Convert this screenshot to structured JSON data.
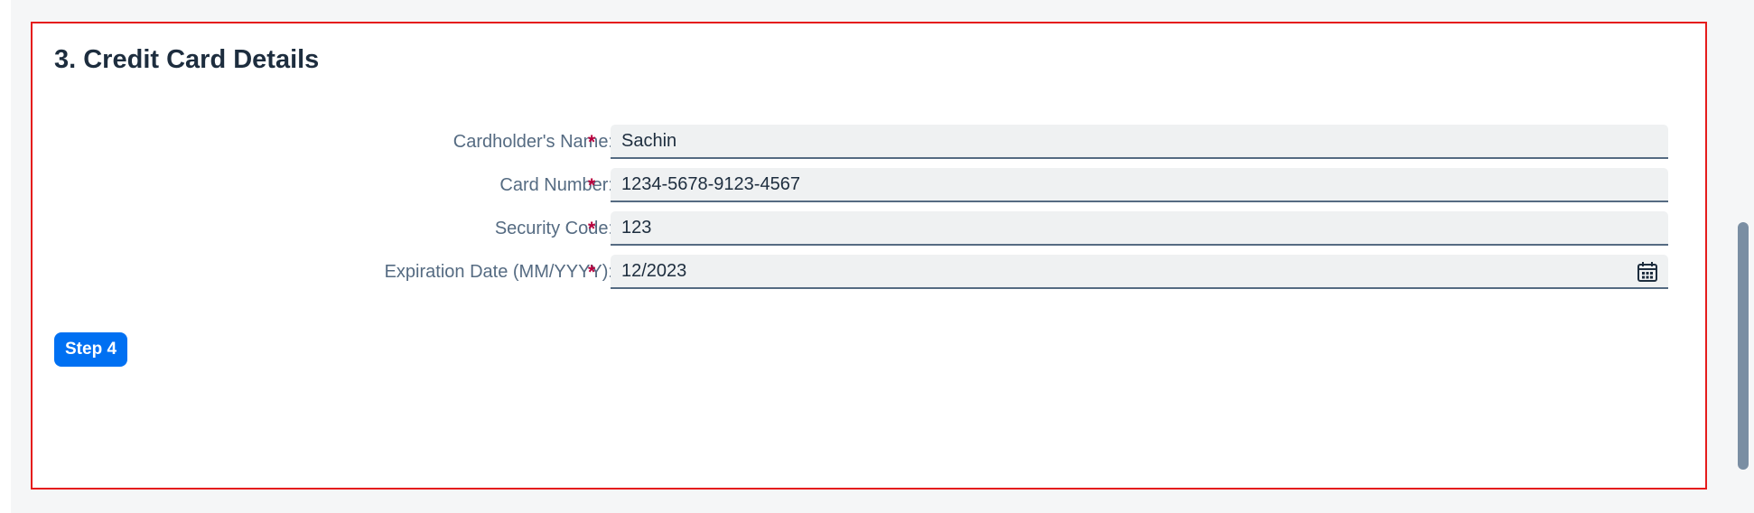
{
  "section": {
    "title": "3. Credit Card Details"
  },
  "form": {
    "required_marker": "*",
    "fields": [
      {
        "label": "Cardholder's Name:",
        "value": "Sachin"
      },
      {
        "label": "Card Number:",
        "value": "1234-5678-9123-4567"
      },
      {
        "label": "Security Code:",
        "value": "123"
      },
      {
        "label": "Expiration Date (MM/YYYY):",
        "value": "12/2023",
        "icon": "calendar-icon"
      }
    ]
  },
  "actions": {
    "next_step_label": "Step 4"
  },
  "colors": {
    "panel_border": "#e51c1c",
    "button_bg": "#0070f2",
    "required_marker": "#b8003d",
    "label_text": "#556b82"
  }
}
